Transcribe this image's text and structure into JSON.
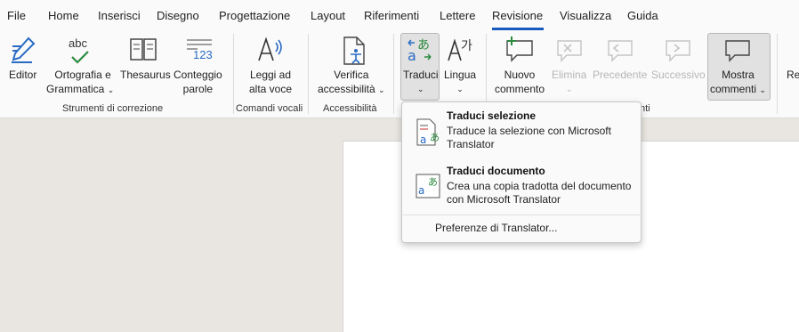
{
  "tabs": [
    "File",
    "Home",
    "Inserisci",
    "Disegno",
    "Progettazione",
    "Layout",
    "Riferimenti",
    "Lettere",
    "Revisione",
    "Visualizza",
    "Guida"
  ],
  "active_tab": "Revisione",
  "ribbon": {
    "editor": "Editor",
    "ortografia_line1": "Ortografia e",
    "ortografia_line2": "Grammatica",
    "thesaurus": "Thesaurus",
    "conteggio_line1": "Conteggio",
    "conteggio_line2": "parole",
    "leggi_line1": "Leggi ad",
    "leggi_line2": "alta voce",
    "verifica_line1": "Verifica",
    "verifica_line2": "accessibilità",
    "traduci": "Traduci",
    "lingua": "Lingua",
    "nuovo_line1": "Nuovo",
    "nuovo_line2": "commento",
    "elimina": "Elimina",
    "precedente": "Precedente",
    "successivo": "Successivo",
    "mostra_line1": "Mostra",
    "mostra_line2": "commenti",
    "partial_next": "Re",
    "abc_text": "abc",
    "num_text": "123",
    "chevron": "⌄"
  },
  "groups": {
    "strumenti": "Strumenti di correzione",
    "comandi": "Comandi vocali",
    "accessibilita": "Accessibilità",
    "commenti_partial": "nti"
  },
  "dropdown": {
    "item1_title": "Traduci selezione",
    "item1_desc": "Traduce la selezione con Microsoft Translator",
    "item2_title": "Traduci documento",
    "item2_desc": "Crea una copia tradotta del documento con Microsoft Translator",
    "preferences": "Preferenze di Translator..."
  },
  "colors": {
    "accent": "#185abd",
    "green": "#2b8a3e",
    "icon_blue": "#2a6cc4"
  }
}
